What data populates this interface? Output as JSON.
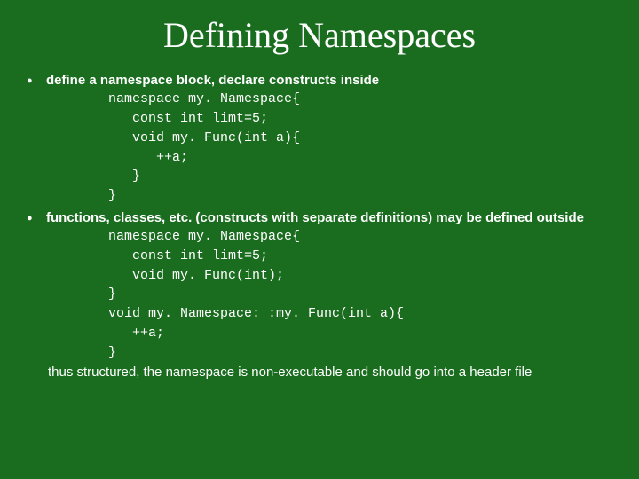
{
  "title": "Defining Namespaces",
  "bullets": {
    "b1": {
      "text": "define a namespace block, declare constructs inside",
      "code": "namespace my. Namespace{\n   const int limt=5;\n   void my. Func(int a){\n      ++a;\n   }\n}"
    },
    "b2": {
      "text": "functions, classes, etc. (constructs with separate definitions) may be defined outside",
      "code": "namespace my. Namespace{\n   const int limt=5;\n   void my. Func(int);\n}\nvoid my. Namespace: :my. Func(int a){\n   ++a;\n}",
      "tail": "thus structured, the namespace is non-executable and should go into a header file"
    }
  }
}
